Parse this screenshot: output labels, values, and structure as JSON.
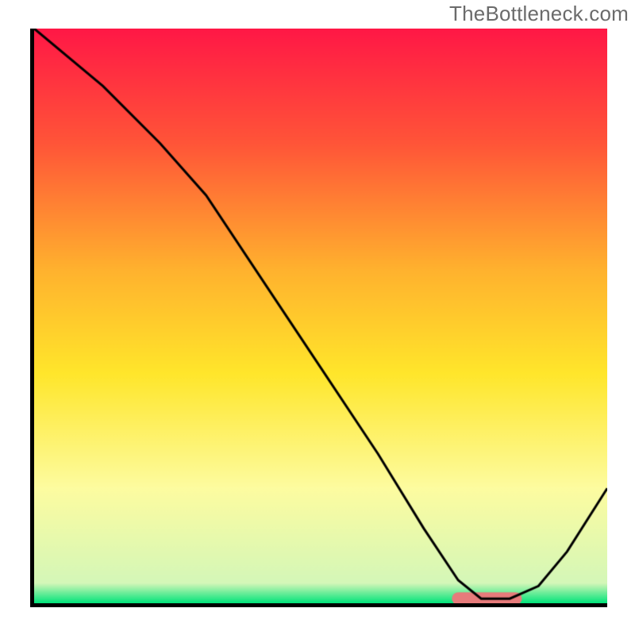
{
  "watermark": "TheBottleneck.com",
  "chart_data": {
    "type": "line",
    "title": "",
    "xlabel": "",
    "ylabel": "",
    "xlim": [
      0,
      100
    ],
    "ylim": [
      0,
      100
    ],
    "watermark_text": "TheBottleneck.com",
    "gradient_stops": [
      {
        "pos": 0.0,
        "color": "#ff1846"
      },
      {
        "pos": 0.2,
        "color": "#ff5538"
      },
      {
        "pos": 0.42,
        "color": "#ffb22e"
      },
      {
        "pos": 0.6,
        "color": "#ffe62b"
      },
      {
        "pos": 0.8,
        "color": "#fdfca0"
      },
      {
        "pos": 0.965,
        "color": "#d4f7b8"
      },
      {
        "pos": 1.0,
        "color": "#00e37a"
      }
    ],
    "series": [
      {
        "name": "bottleneck-curve",
        "color": "#000000",
        "x": [
          0,
          12,
          22,
          30,
          40,
          50,
          60,
          68,
          74,
          78,
          83,
          88,
          93,
          100
        ],
        "y": [
          100,
          90,
          80,
          71,
          56,
          41,
          26,
          13,
          4,
          0.8,
          0.8,
          3,
          9,
          20
        ]
      }
    ],
    "marker": {
      "name": "optimal-zone",
      "color": "#e77b7b",
      "x_start": 74,
      "x_end": 84,
      "y": 0.8,
      "thickness_pct": 2.2
    }
  }
}
